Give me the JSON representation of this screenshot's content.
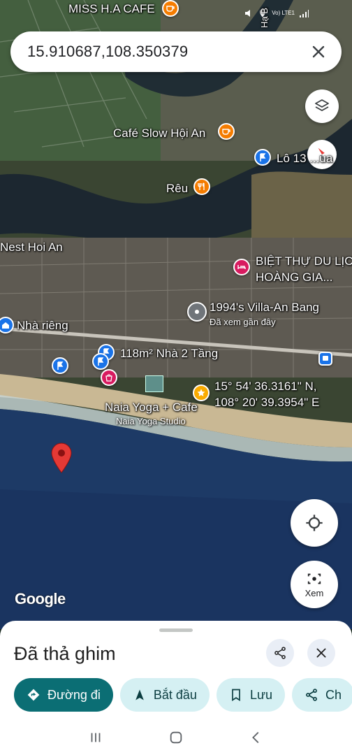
{
  "status_bar": {
    "network": "Vo) LTE1"
  },
  "search": {
    "value": "15.910687,108.350379",
    "clear_icon": "close-icon"
  },
  "map": {
    "labels": {
      "cafe_top": "MISS H.A CAFE",
      "cafe_slow": "Café Slow Hội An",
      "lo13": "Lô 13 ...ua",
      "reu": "Rêu",
      "nest": "Nest Hoi An",
      "biet_thu_1": "BIỆT THỰ DU LỊC",
      "biet_thu_2": "HOÀNG GIA...",
      "villa": "1994's Villa-An Bang",
      "villa_sub": "Đã xem gần đây",
      "nha_rieng": "Nhà riêng",
      "nha_2_tang": "118m² Nhà 2 Tầng",
      "coord_1": "15° 54' 36.3161\" N,",
      "coord_2": "108° 20' 39.3954\" E",
      "naia": "Naia Yoga + Cafe",
      "naia_sub": "Naia Yoga Studio",
      "road_top": "Hạ B"
    },
    "google_logo": "Google",
    "xem_label": "Xem"
  },
  "sheet": {
    "title": "Đã thả ghim",
    "chips": [
      "Đường đi",
      "Bắt đầu",
      "Lưu",
      "Ch"
    ]
  },
  "colors": {
    "primary_chip": "#0b6e74",
    "secondary_chip": "#d5f0f3",
    "pin_red": "#e53935",
    "poi_orange": "#f57c00",
    "poi_blue": "#1a73e8",
    "poi_pink": "#d81b60"
  }
}
